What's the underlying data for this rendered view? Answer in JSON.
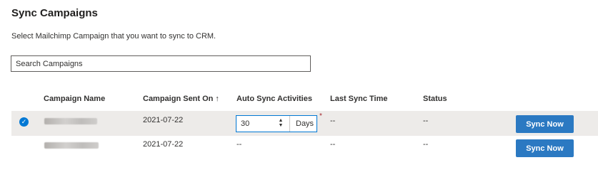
{
  "header": {
    "title": "Sync Campaigns",
    "subtitle": "Select Mailchimp Campaign that you want to sync to CRM."
  },
  "search": {
    "placeholder": "Search Campaigns",
    "value": ""
  },
  "table": {
    "columns": {
      "name": "Campaign Name",
      "sent_on": "Campaign Sent On",
      "sent_on_sort_icon": "↑",
      "auto_sync": "Auto Sync Activities",
      "last_sync": "Last Sync Time",
      "status": "Status"
    },
    "rows": [
      {
        "selected": true,
        "check_icon": "✓",
        "sent_on": "2021-07-22",
        "auto_sync_value": "30",
        "auto_sync_unit": "Days",
        "required_mark": "*",
        "spin_up": "▲",
        "spin_down": "▼",
        "last_sync": "--",
        "status": "--",
        "action": "Sync Now"
      },
      {
        "selected": false,
        "sent_on": "2021-07-22",
        "auto_sync": "--",
        "last_sync": "--",
        "status": "--",
        "action": "Sync Now"
      }
    ]
  },
  "colors": {
    "accent": "#0078d4",
    "button": "#2b79c2",
    "selected_row": "#edebe9",
    "required": "#a4262c"
  }
}
